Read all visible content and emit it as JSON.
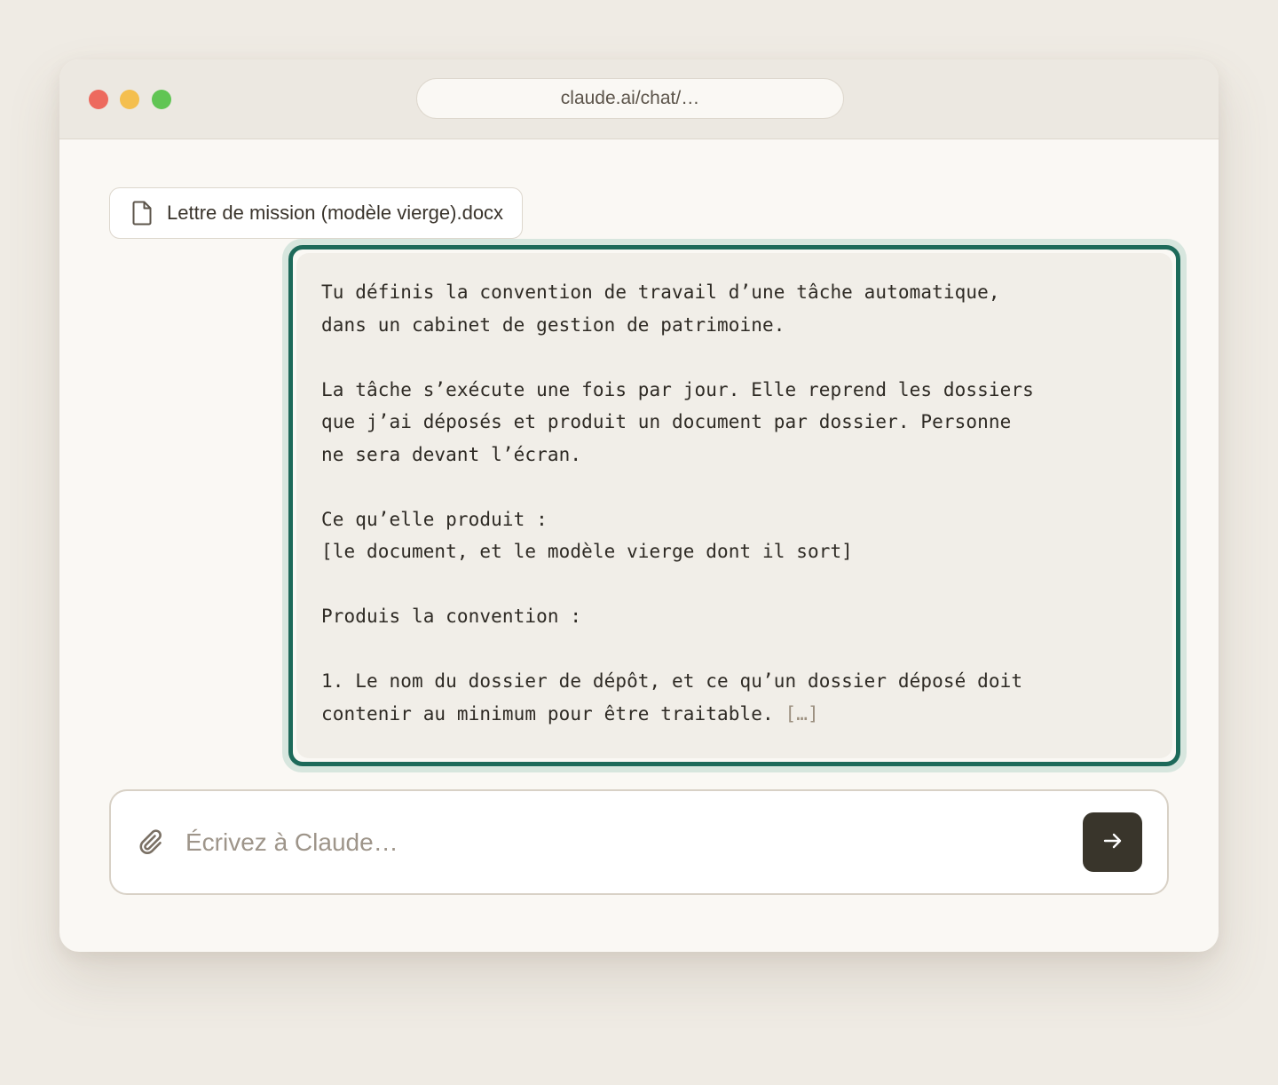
{
  "browser": {
    "url": "claude.ai/chat/…",
    "traffic_lights": [
      "close",
      "minimize",
      "maximize"
    ]
  },
  "attachment": {
    "icon": "document-icon",
    "filename": "Lettre de mission (modèle vierge).docx"
  },
  "message": {
    "text": "Tu définis la convention de travail d’une tâche automatique,\ndans un cabinet de gestion de patrimoine.\n\nLa tâche s’exécute une fois par jour. Elle reprend les dossiers\nque j’ai déposés et produit un document par dossier. Personne\nne sera devant l’écran.\n\nCe qu’elle produit :\n[le document, et le modèle vierge dont il sort]\n\nProduis la convention :\n\n1. Le nom du dossier de dépôt, et ce qu’un dossier déposé doit\ncontenir au minimum pour être traitable. ",
    "truncation": "[…]",
    "highlight_color": "#1d6a5a"
  },
  "composer": {
    "placeholder": "Écrivez à Claude…",
    "attach_icon": "paperclip-icon",
    "send_icon": "arrow-right-icon"
  }
}
